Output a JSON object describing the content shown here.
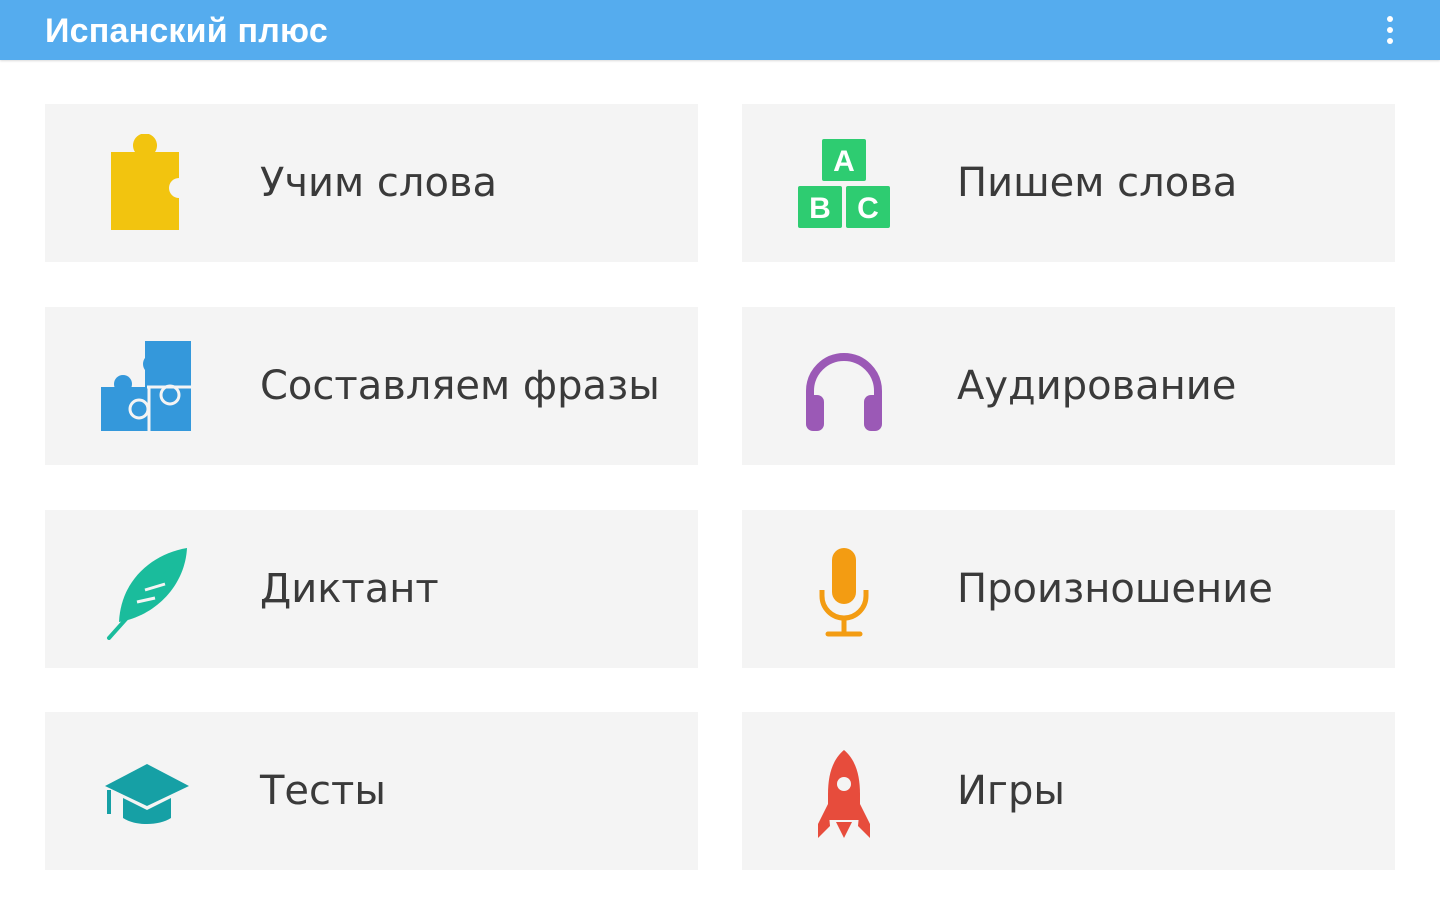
{
  "appbar": {
    "title": "Испанский плюс",
    "color": "#55acee",
    "menu_icon": "overflow-menu-icon"
  },
  "tiles": [
    {
      "label": "Учим слова",
      "icon": "puzzle-piece-icon",
      "color": "#f2c40f"
    },
    {
      "label": "Пишем слова",
      "icon": "abc-blocks-icon",
      "color": "#2ecc71"
    },
    {
      "label": "Составляем фразы",
      "icon": "puzzle-pieces-icon",
      "color": "#3498db"
    },
    {
      "label": "Аудирование",
      "icon": "headphones-icon",
      "color": "#9b59b6"
    },
    {
      "label": "Диктант",
      "icon": "feather-icon",
      "color": "#1abc9c"
    },
    {
      "label": "Произношение",
      "icon": "microphone-icon",
      "color": "#f39c12"
    },
    {
      "label": "Тесты",
      "icon": "graduation-cap-icon",
      "color": "#16a0a5"
    },
    {
      "label": "Игры",
      "icon": "rocket-icon",
      "color": "#e74c3c"
    }
  ],
  "abc_letters": [
    "A",
    "B",
    "C"
  ]
}
